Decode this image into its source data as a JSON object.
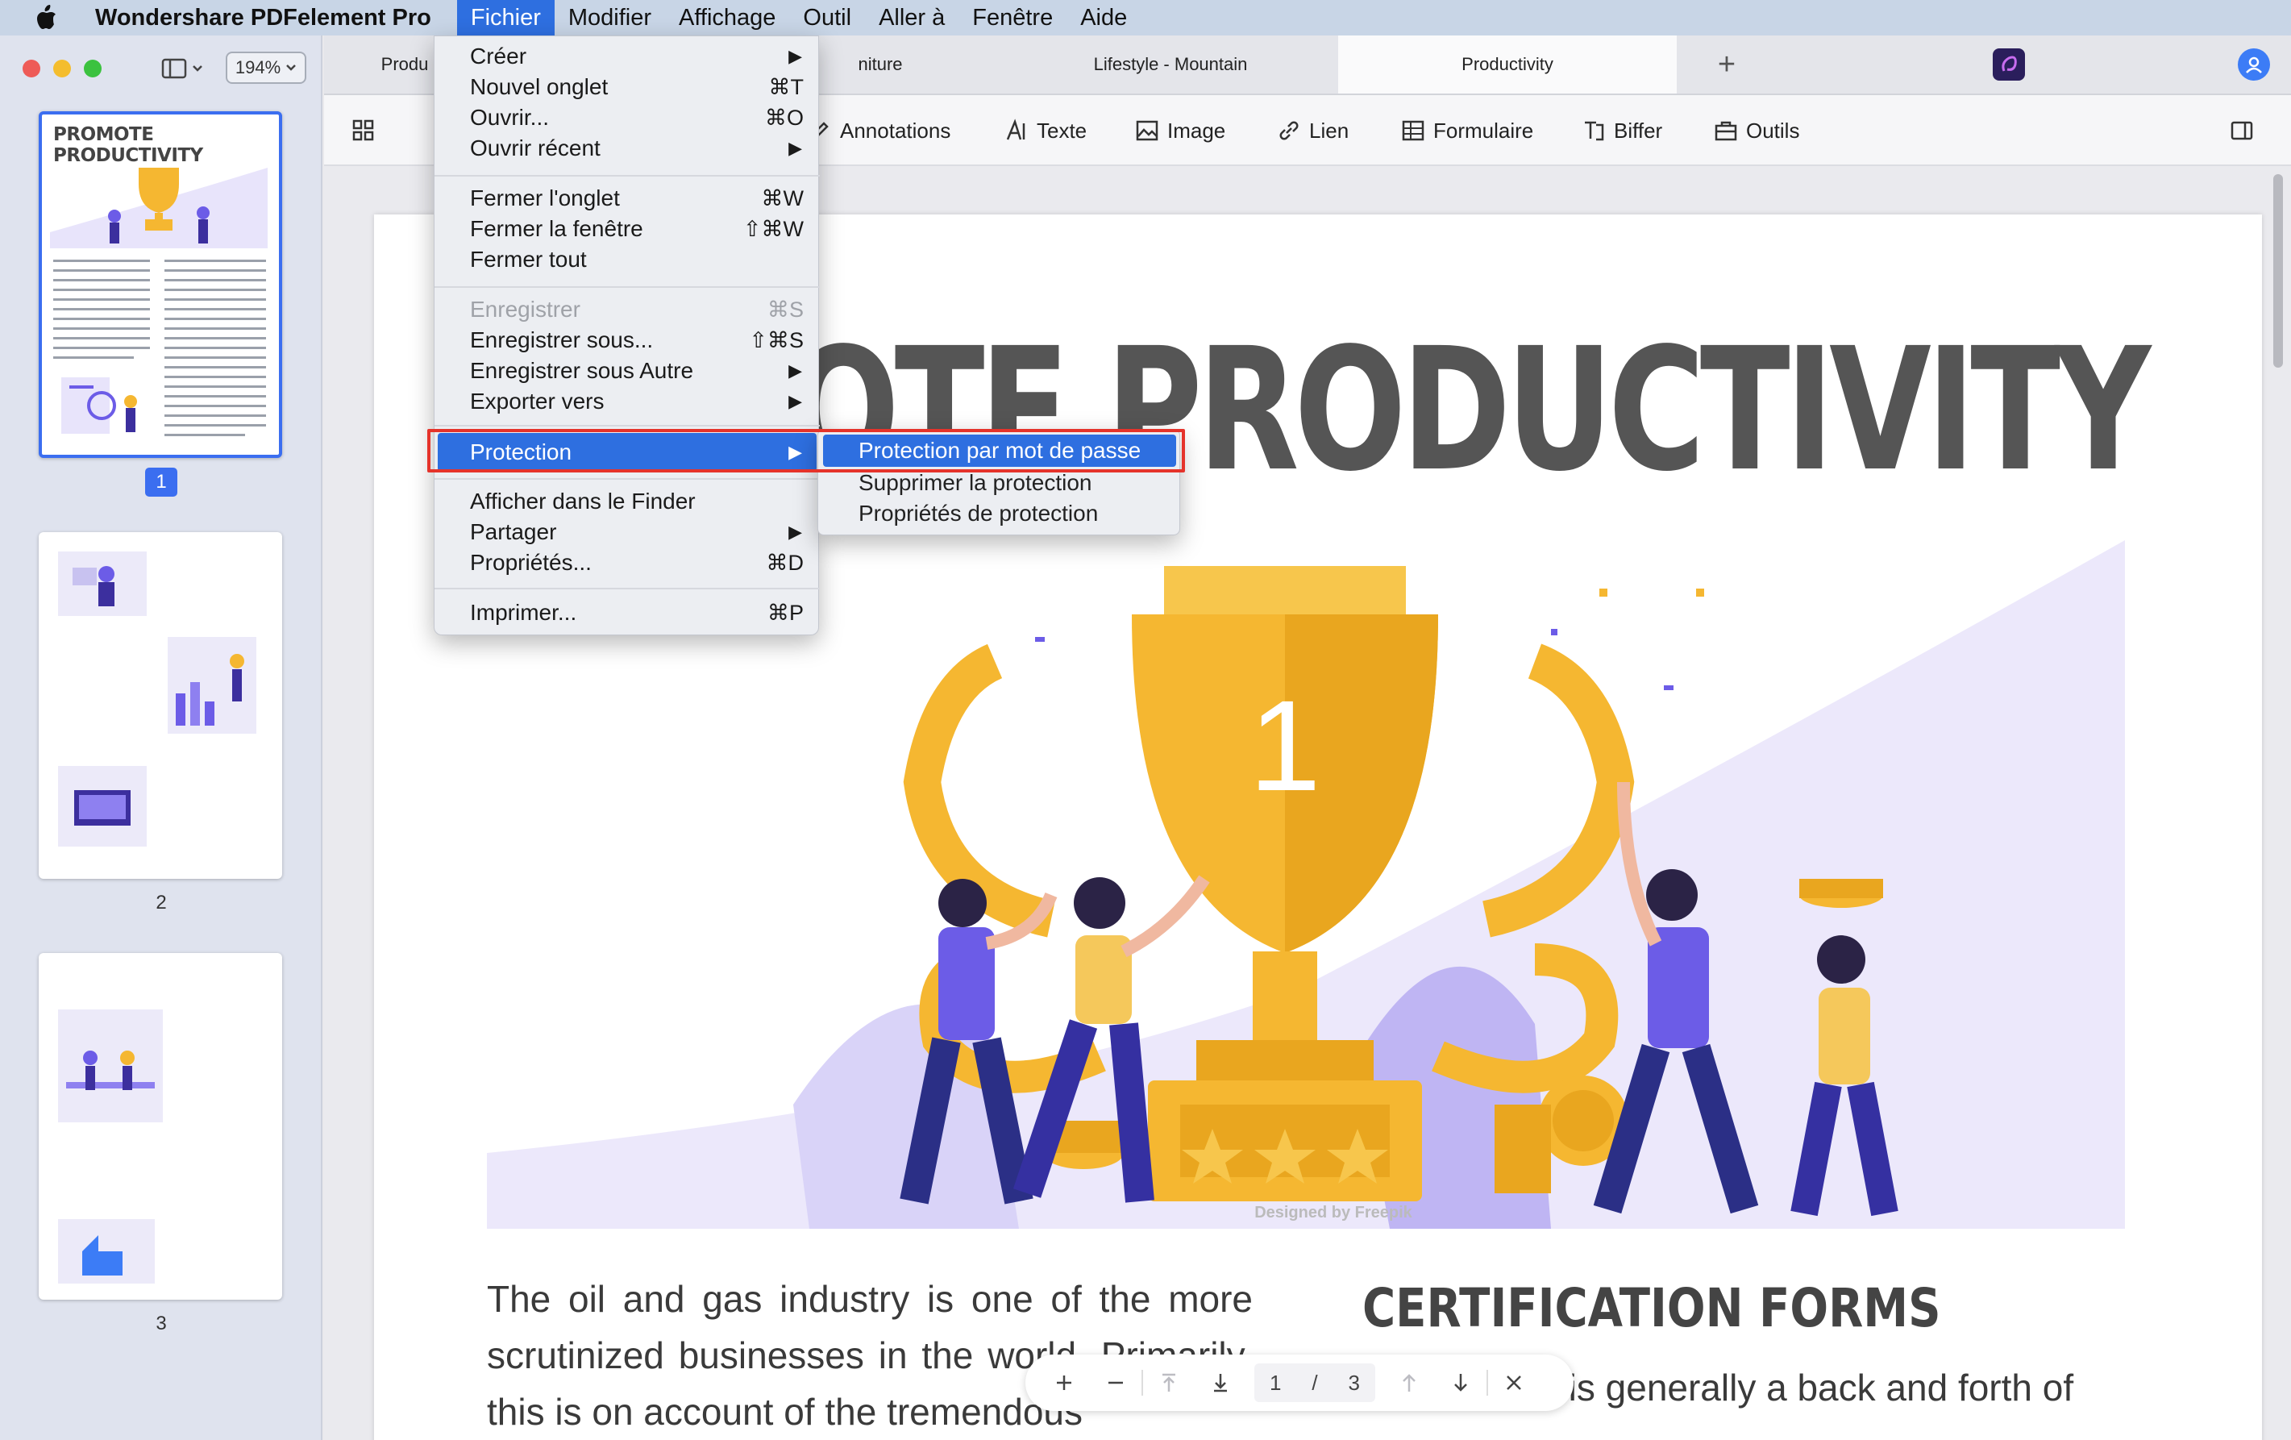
{
  "menubar": {
    "app_name": "Wondershare PDFelement Pro",
    "items": [
      "Fichier",
      "Modifier",
      "Affichage",
      "Outil",
      "Aller à",
      "Fenêtre",
      "Aide"
    ]
  },
  "sidebar": {
    "zoom": "194%",
    "pages": [
      {
        "number": "1",
        "title": "PROMOTE PRODUCTIVITY"
      },
      {
        "number": "2"
      },
      {
        "number": "3"
      }
    ]
  },
  "tabs": {
    "items": [
      "Produ",
      "niture",
      "Lifestyle - Mountain",
      "Productivity"
    ],
    "active": "Productivity",
    "add_label": "+"
  },
  "toolbar": {
    "items": [
      "Annotations",
      "Texte",
      "Image",
      "Lien",
      "Formulaire",
      "Biffer",
      "Outils"
    ]
  },
  "document": {
    "title": "MOTE PRODUCTIVITY",
    "illustration_credit": "Designed by Freepik",
    "trophy_number": "1",
    "body_text": "The oil and gas industry is one of the more scrutinized businesses in the world. Primarily, this is on account of the tremendous",
    "section_title": "CERTIFICATION FORMS",
    "section_body": "Certification is generally a back and forth of"
  },
  "page_nav": {
    "current": "1",
    "separator": "/",
    "total": "3"
  },
  "fichier_menu": {
    "groups": [
      [
        {
          "label": "Créer",
          "arrow": true
        },
        {
          "label": "Nouvel onglet",
          "shortcut": "⌘T"
        },
        {
          "label": "Ouvrir...",
          "shortcut": "⌘O"
        },
        {
          "label": "Ouvrir récent",
          "arrow": true
        }
      ],
      [
        {
          "label": "Fermer l'onglet",
          "shortcut": "⌘W"
        },
        {
          "label": "Fermer la fenêtre",
          "shortcut": "⇧⌘W"
        },
        {
          "label": "Fermer tout"
        }
      ],
      [
        {
          "label": "Enregistrer",
          "shortcut": "⌘S",
          "disabled": true
        },
        {
          "label": "Enregistrer sous...",
          "shortcut": "⇧⌘S"
        },
        {
          "label": "Enregistrer sous Autre",
          "arrow": true
        },
        {
          "label": "Exporter vers",
          "arrow": true
        }
      ],
      [
        {
          "label": "Protection",
          "arrow": true,
          "highlighted": true
        }
      ],
      [
        {
          "label": "Afficher dans le Finder"
        },
        {
          "label": "Partager",
          "arrow": true
        },
        {
          "label": "Propriétés...",
          "shortcut": "⌘D"
        }
      ],
      [
        {
          "label": "Imprimer...",
          "shortcut": "⌘P"
        }
      ]
    ],
    "arrow_glyph": "▶"
  },
  "protection_submenu": {
    "items": [
      "Protection par mot de passe",
      "Supprimer la protection",
      "Propriétés de protection"
    ],
    "highlighted": "Protection par mot de passe"
  },
  "colors": {
    "accent": "#2e6fe0",
    "highlight_outline": "#e5332b",
    "illustration_purple": "#6c5ce7",
    "trophy_gold": "#f5b731"
  }
}
